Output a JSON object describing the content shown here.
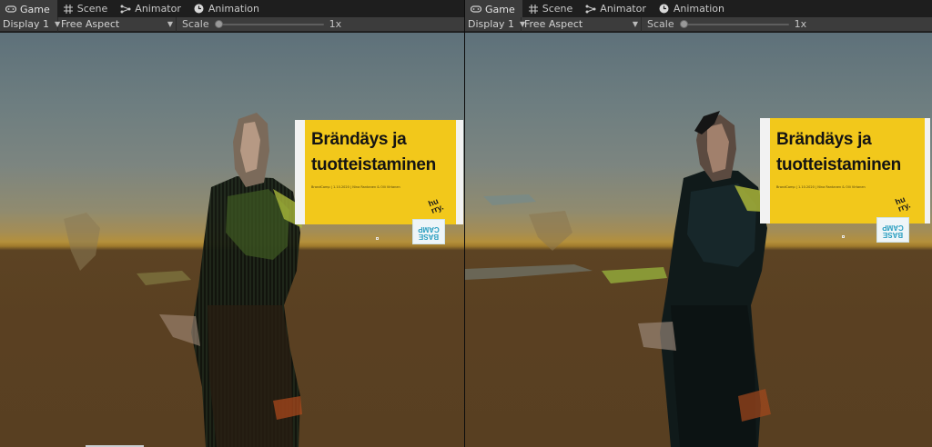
{
  "panes": [
    {
      "tabs": [
        {
          "label": "Game",
          "icon": "gamepad-icon",
          "active": true
        },
        {
          "label": "Scene",
          "icon": "grid-icon",
          "active": false
        },
        {
          "label": "Animator",
          "icon": "animator-nodes-icon",
          "active": false
        },
        {
          "label": "Animation",
          "icon": "clock-icon",
          "active": false
        }
      ],
      "display": "Display 1",
      "aspect": "Free Aspect",
      "scale_label": "Scale",
      "scale_value": "1x",
      "scale_fraction": 0.0,
      "sign": {
        "title_line1": "Brändäys ja",
        "title_line2": "tuotteistaminen",
        "subtitle": "BrandCamp | 1.10.2020 | Nina Rantanen & Olli Virtanen",
        "logo": "hu\nrry."
      },
      "badge": "BASE\nCAMP"
    },
    {
      "tabs": [
        {
          "label": "Game",
          "icon": "gamepad-icon",
          "active": true
        },
        {
          "label": "Scene",
          "icon": "grid-icon",
          "active": false
        },
        {
          "label": "Animator",
          "icon": "animator-nodes-icon",
          "active": false
        },
        {
          "label": "Animation",
          "icon": "clock-icon",
          "active": false
        }
      ],
      "display": "Display 1",
      "aspect": "Free Aspect",
      "scale_label": "Scale",
      "scale_value": "1x",
      "scale_fraction": 0.0,
      "sign": {
        "title_line1": "Brändäys ja",
        "title_line2": "tuotteistaminen",
        "subtitle": "BrandCamp | 1.10.2020 | Nina Rantanen & Olli Virtanen",
        "logo": "hu\nrry."
      },
      "badge": "BASE\nCAMP"
    }
  ],
  "colors": {
    "editor_bg": "#3c3c3c",
    "tab_active": "#3c3c3c",
    "sign_yellow": "#f2c81b",
    "ground": "#5a4022",
    "sky": "#6e7e80"
  }
}
